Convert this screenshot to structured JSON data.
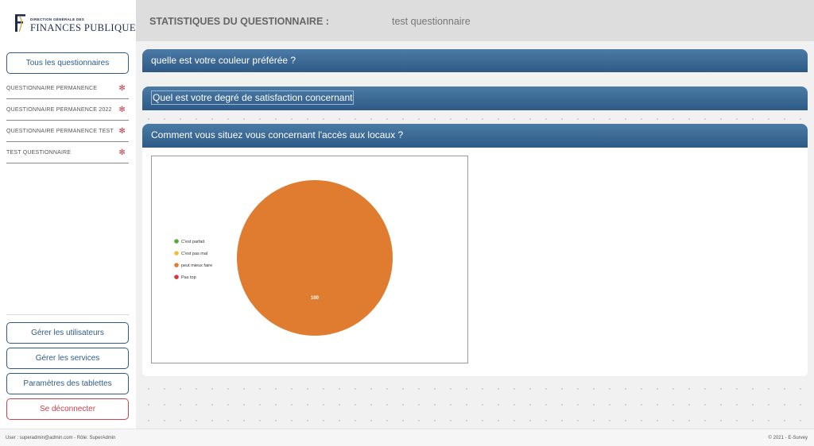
{
  "sidebar": {
    "logo": {
      "small": "DIRECTION GÉNÉRALE DES",
      "big": "FINANCES PUBLIQUES"
    },
    "all_questionnaires_label": "Tous les questionnaires",
    "questionnaires": [
      {
        "label": "QUESTIONNAIRE PERMANENCE",
        "icon": "gear-icon"
      },
      {
        "label": "QUESTIONNAIRE PERMANENCE 2022",
        "icon": "gear-icon"
      },
      {
        "label": "QUESTIONNAIRE PERMANENCE TEST",
        "icon": "gear-icon"
      },
      {
        "label": "TEST QUESTIONNAIRE",
        "icon": "gear-icon"
      }
    ],
    "manage_users_label": "Gérer les utilisateurs",
    "manage_services_label": "Gérer les services",
    "tablet_settings_label": "Paramètres des tablettes",
    "logout_label": "Se déconnecter"
  },
  "header": {
    "title": "STATISTIQUES DU QUESTIONNAIRE :",
    "questionnaire_name": "test questionnaire"
  },
  "questions": [
    {
      "label": "quelle est votre couleur préférée ?"
    },
    {
      "label": "Quel est votre degré de satisfaction concernant"
    },
    {
      "label": "Comment vous situez vous concernant l'accès aux locaux ?"
    }
  ],
  "chart_data": {
    "type": "pie",
    "categories": [
      "C'est parfait",
      "C'est pas mal",
      "peut mieux faire",
      "Pas top"
    ],
    "values": [
      0,
      0,
      100,
      0
    ],
    "colors": [
      "#5aa838",
      "#ecc137",
      "#e07c2f",
      "#d43a2f"
    ],
    "data_labels": [
      "",
      "",
      "100",
      ""
    ],
    "legend_position": "left"
  },
  "footer": {
    "user_info": "User : superadmin@admin.com - Rôle: SuperAdmin",
    "copyright": "© 2021 - E-Survey"
  },
  "colors": {
    "primary": "#2f5b85",
    "danger": "#c9444d",
    "header_bg": "#dddddd"
  }
}
